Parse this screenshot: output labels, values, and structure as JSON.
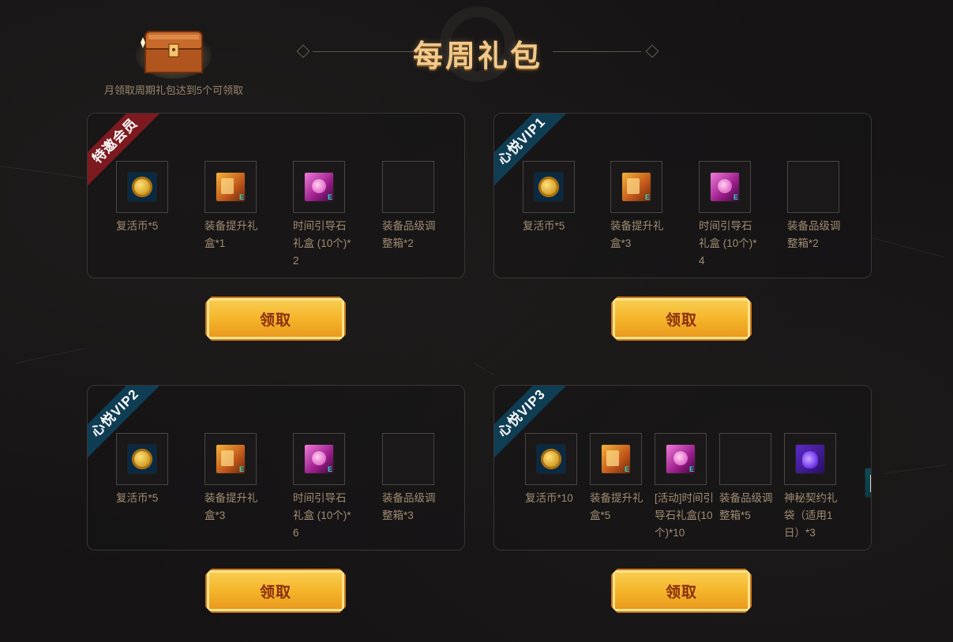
{
  "header": {
    "title": "每周礼包",
    "chest_note": "月领取周期礼包达到5个可领取"
  },
  "panels": [
    {
      "badge": "特邀会员",
      "badge_color": "#7c1a1f",
      "button": "领取",
      "items": [
        {
          "icon": "revive-coin-icon",
          "name": "复活币*5"
        },
        {
          "icon": "equipment-box-icon",
          "name": "装备提升礼盒*1"
        },
        {
          "icon": "guide-stone-icon",
          "name": "时间引导石礼盒 (10个)*2"
        },
        {
          "icon": "grade-chest-icon",
          "name": "装备品级调整箱*2"
        }
      ]
    },
    {
      "badge": "心悦VIP1",
      "badge_color": "#0f3d54",
      "button": "领取",
      "items": [
        {
          "icon": "revive-coin-icon",
          "name": "复活币*5"
        },
        {
          "icon": "equipment-box-icon",
          "name": "装备提升礼盒*3"
        },
        {
          "icon": "guide-stone-icon",
          "name": "时间引导石礼盒 (10个)*4"
        },
        {
          "icon": "grade-chest-icon",
          "name": "装备品级调整箱*2"
        }
      ]
    },
    {
      "badge": "心悦VIP2",
      "badge_color": "#0f3d54",
      "button": "领取",
      "items": [
        {
          "icon": "revive-coin-icon",
          "name": "复活币*5"
        },
        {
          "icon": "equipment-box-icon",
          "name": "装备提升礼盒*3"
        },
        {
          "icon": "guide-stone-icon",
          "name": "时间引导石礼盒 (10个)*6"
        },
        {
          "icon": "grade-chest-icon",
          "name": "装备品级调整箱*3"
        }
      ]
    },
    {
      "badge": "心悦VIP3",
      "badge_color": "#0f3d54",
      "button": "领取",
      "items": [
        {
          "icon": "revive-coin-icon",
          "name": "复活币*10"
        },
        {
          "icon": "equipment-box-icon",
          "name": "装备提升礼盒*5"
        },
        {
          "icon": "guide-stone-icon",
          "name": "[活动]时间引导石礼盒(10个)*10"
        },
        {
          "icon": "grade-chest-icon",
          "name": "装备品级调整箱*5"
        },
        {
          "icon": "contract-bag-icon",
          "name": "神秘契约礼袋（适用1日）*3"
        }
      ]
    }
  ]
}
